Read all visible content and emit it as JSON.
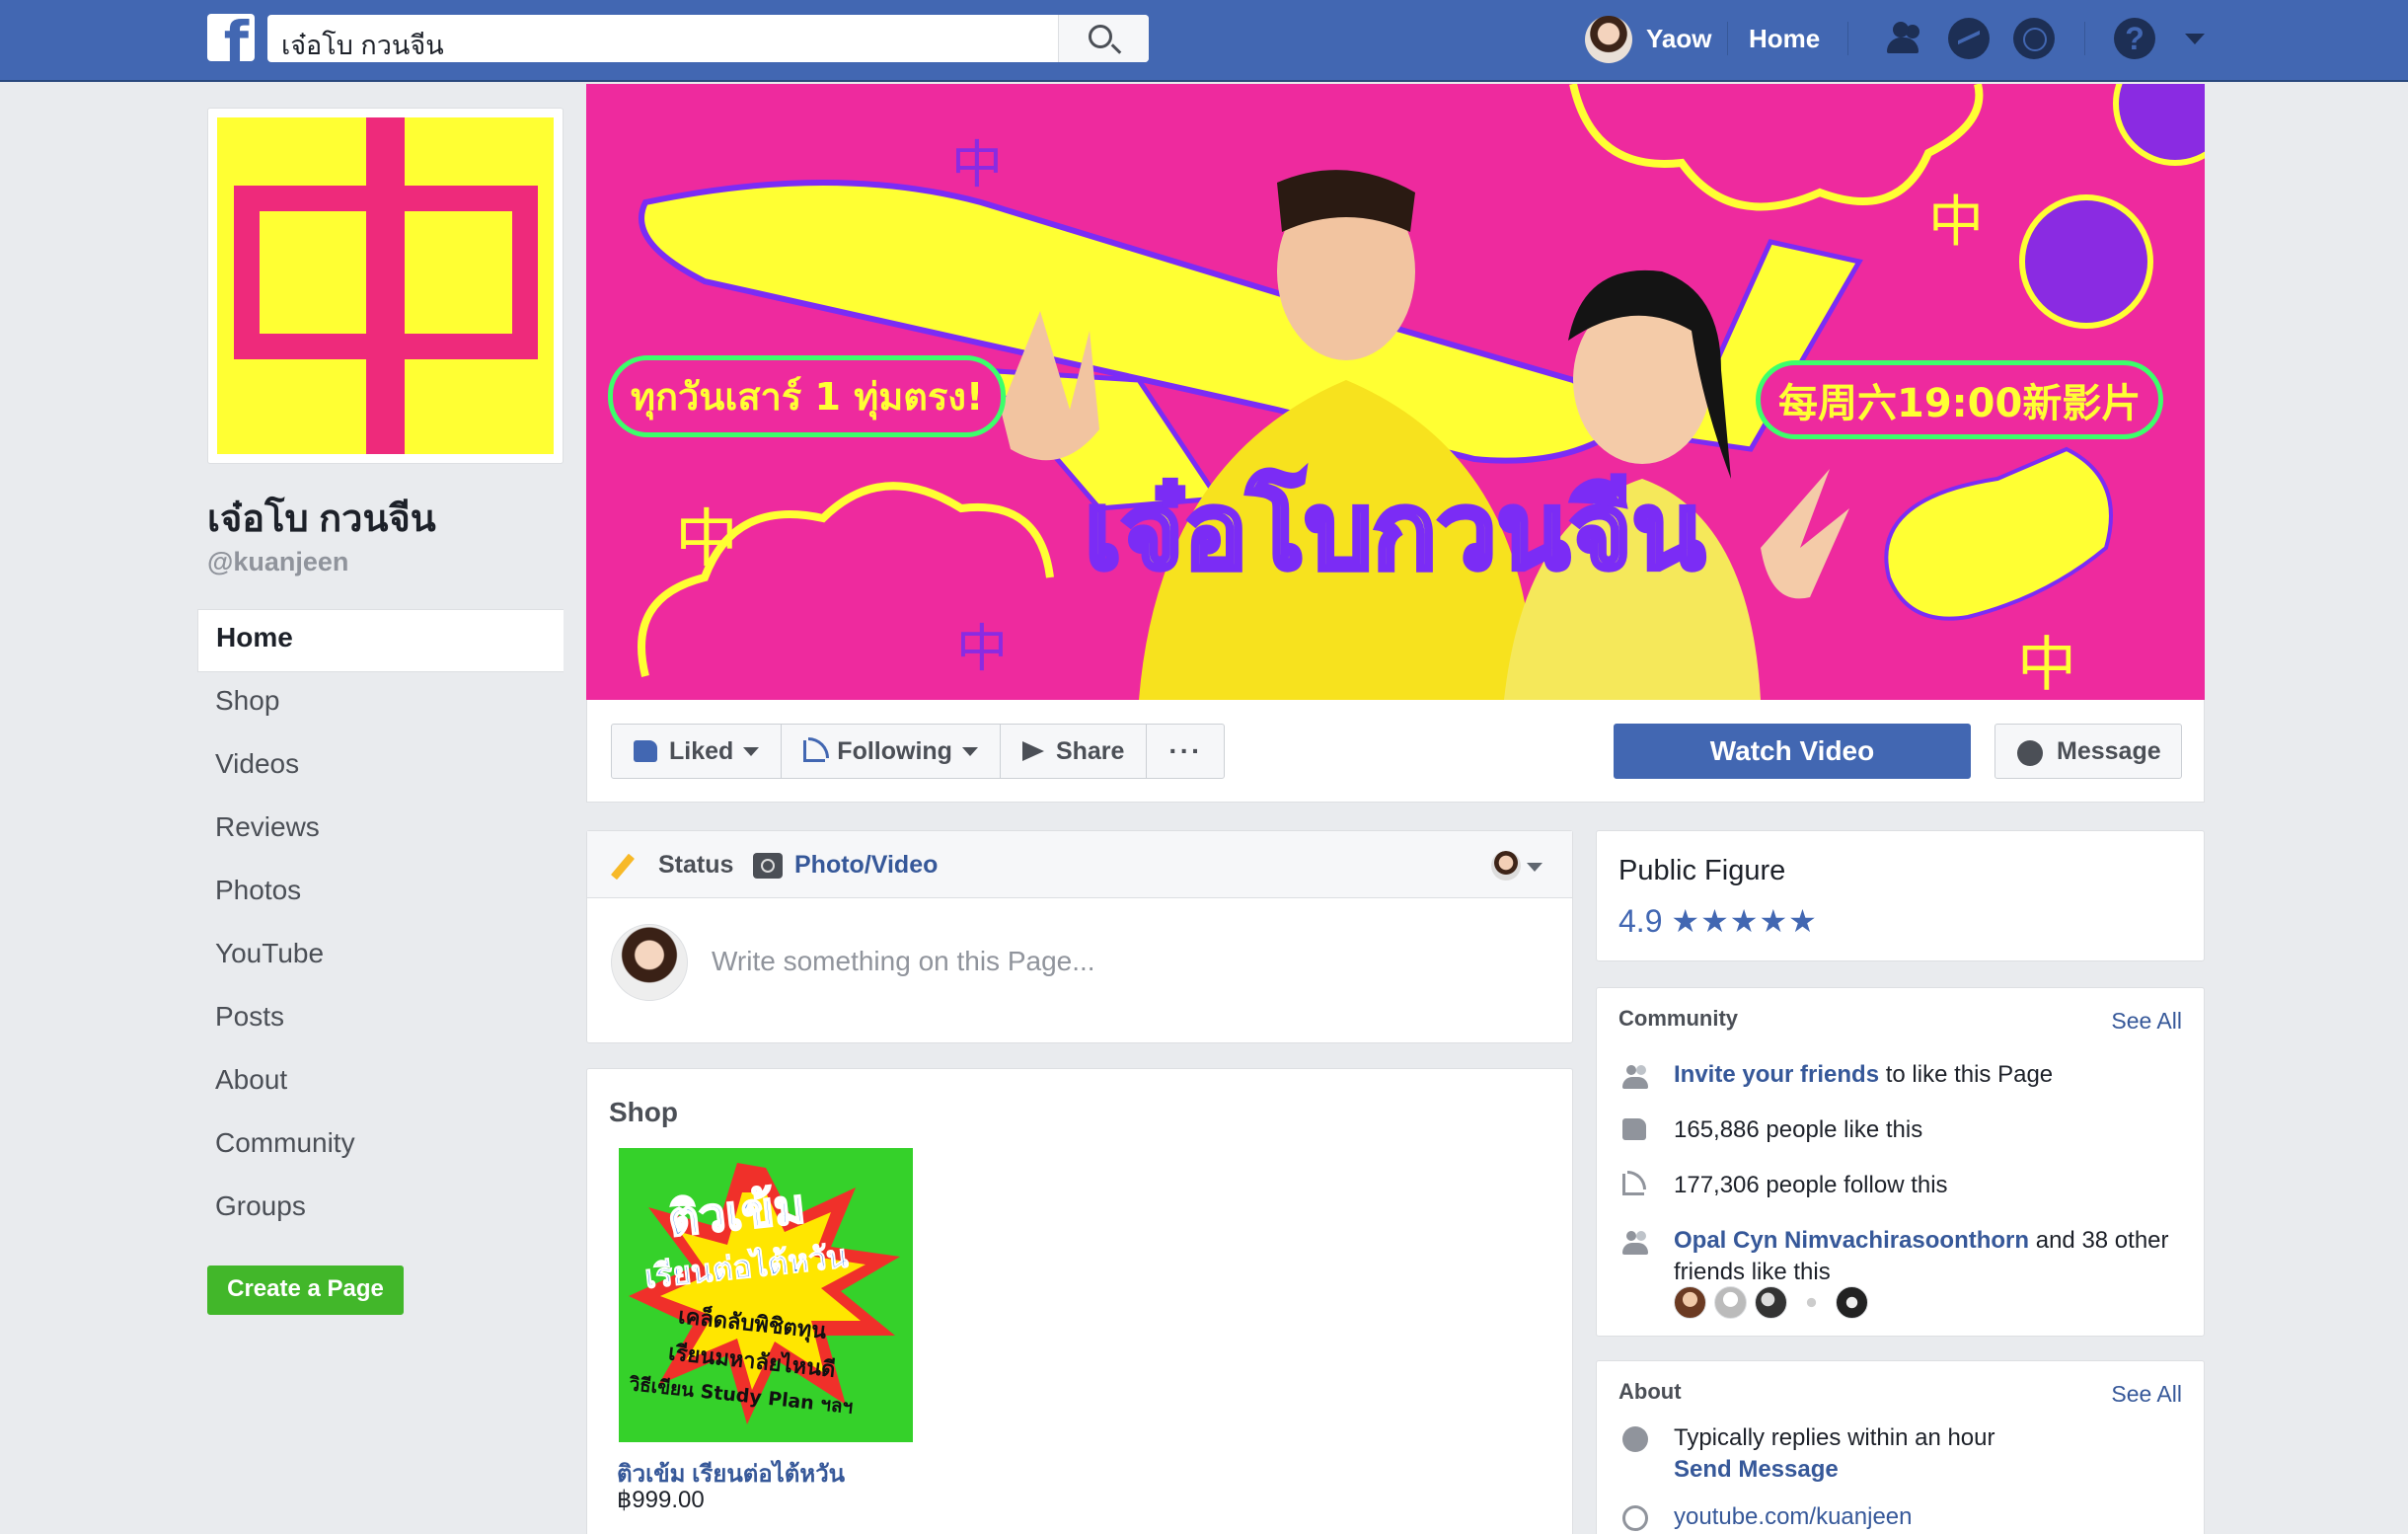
{
  "topbar": {
    "logo": "f",
    "search_value": "เจ๋อโบ กวนจีน",
    "user_name": "Yaow",
    "home_label": "Home",
    "help_label": "?"
  },
  "page": {
    "name": "เจ๋อโบ กวนจีน",
    "handle": "@kuanjeen",
    "profile_glyph": "中"
  },
  "nav": {
    "items": [
      "Home",
      "Shop",
      "Videos",
      "Reviews",
      "Photos",
      "YouTube",
      "Posts",
      "About",
      "Community",
      "Groups"
    ],
    "create_page": "Create a Page"
  },
  "cover": {
    "banner_left": "ทุกวันเสาร์ 1 ทุ่มตรง!",
    "banner_right": "每周六19:00新影片",
    "title": "เจ๋อโบกวนจีน",
    "glyph": "中"
  },
  "actions": {
    "liked": "Liked",
    "following": "Following",
    "share": "Share",
    "more": "···",
    "watch_video": "Watch Video",
    "message": "Message"
  },
  "composer": {
    "status_tab": "Status",
    "photo_tab": "Photo/Video",
    "placeholder": "Write something on this Page..."
  },
  "shop": {
    "title": "Shop",
    "item": {
      "image_title": "ติวเข้ม",
      "image_subtitle": "เรียนต่อไต้หวัน",
      "image_line1": "เคล็ดลับพิชิตทุน",
      "image_line2": "เรียนมหาลัยไหนดี",
      "image_line3": "วิธีเขียน Study Plan ฯลฯ",
      "name": "ติวเข้ม เรียนต่อไต้หวัน",
      "price": "฿999.00"
    }
  },
  "public_figure": {
    "title": "Public Figure",
    "rating": "4.9",
    "stars": "★★★★★"
  },
  "community": {
    "title": "Community",
    "see_all": "See All",
    "invite_link": "Invite your friends",
    "invite_rest": " to like this Page",
    "likes": "165,886 people like this",
    "follows": "177,306 people follow this",
    "friend_link": "Opal Cyn Nimvachirasoonthorn",
    "friend_rest": " and 38 other friends like this"
  },
  "about": {
    "title": "About",
    "see_all": "See All",
    "reply_text": "Typically replies within an hour",
    "send_message": "Send Message",
    "website": "youtube.com/kuanjeen"
  },
  "colors": {
    "fb_blue": "#4267b2",
    "cover_pink": "#ee2a9e",
    "cover_yellow": "#ffff33",
    "create_green": "#42b72a"
  }
}
